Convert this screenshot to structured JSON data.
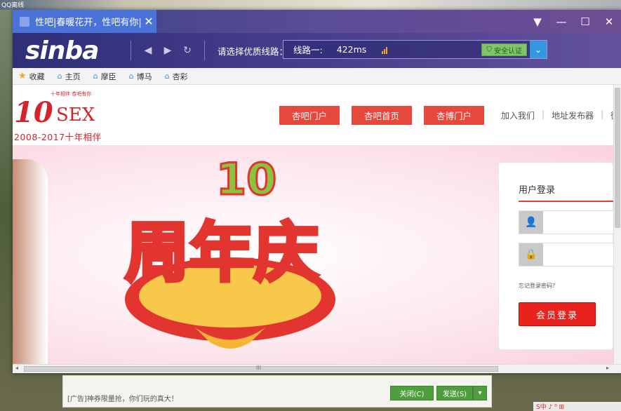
{
  "desktop": {
    "label": "QQ离线"
  },
  "window": {
    "tab_title": "性吧|春暖花开，性吧有你|...",
    "tab_close": "✕",
    "controls": {
      "menu": "▼",
      "minimize": "—",
      "maximize": "☐",
      "close": "✕"
    }
  },
  "toolbar": {
    "logo": "sinba",
    "route_label": "请选择优质线路：",
    "route_name": "线路一:",
    "route_ping": "422ms",
    "secure_label": "安全认证",
    "dropdown": "⌄"
  },
  "favorites": [
    {
      "label": "收藏",
      "icon": "star-icon"
    },
    {
      "label": "主页",
      "icon": "home-icon"
    },
    {
      "label": "摩臣",
      "icon": "home-icon"
    },
    {
      "label": "博马",
      "icon": "home-icon"
    },
    {
      "label": "杏彩",
      "icon": "home-icon"
    }
  ],
  "site": {
    "logo_num": "10",
    "logo_word": "SEX",
    "logo_tagline": "十年相伴 杏吧有你",
    "logo_years": "2008-2017十年相伴",
    "nav_buttons": [
      "杏吧门户",
      "杏吧首页",
      "杏博门户"
    ],
    "links": [
      "加入我们",
      "地址发布器",
      "微杏"
    ],
    "banner": {
      "number": "10",
      "headline": "周年庆"
    },
    "login": {
      "title": "用户登录",
      "forgot": "忘记登录密码？",
      "submit": "会员登录"
    }
  },
  "hscroll": {
    "grip": "III"
  },
  "ad": {
    "text": "[广告]神券限量抢，你们玩的真大！",
    "close_label": "关闭(C)",
    "send_label": "发送(S)",
    "send_menu": "▾"
  },
  "tray": {
    "text": "S中 ♪ ⁰ ⊞"
  }
}
